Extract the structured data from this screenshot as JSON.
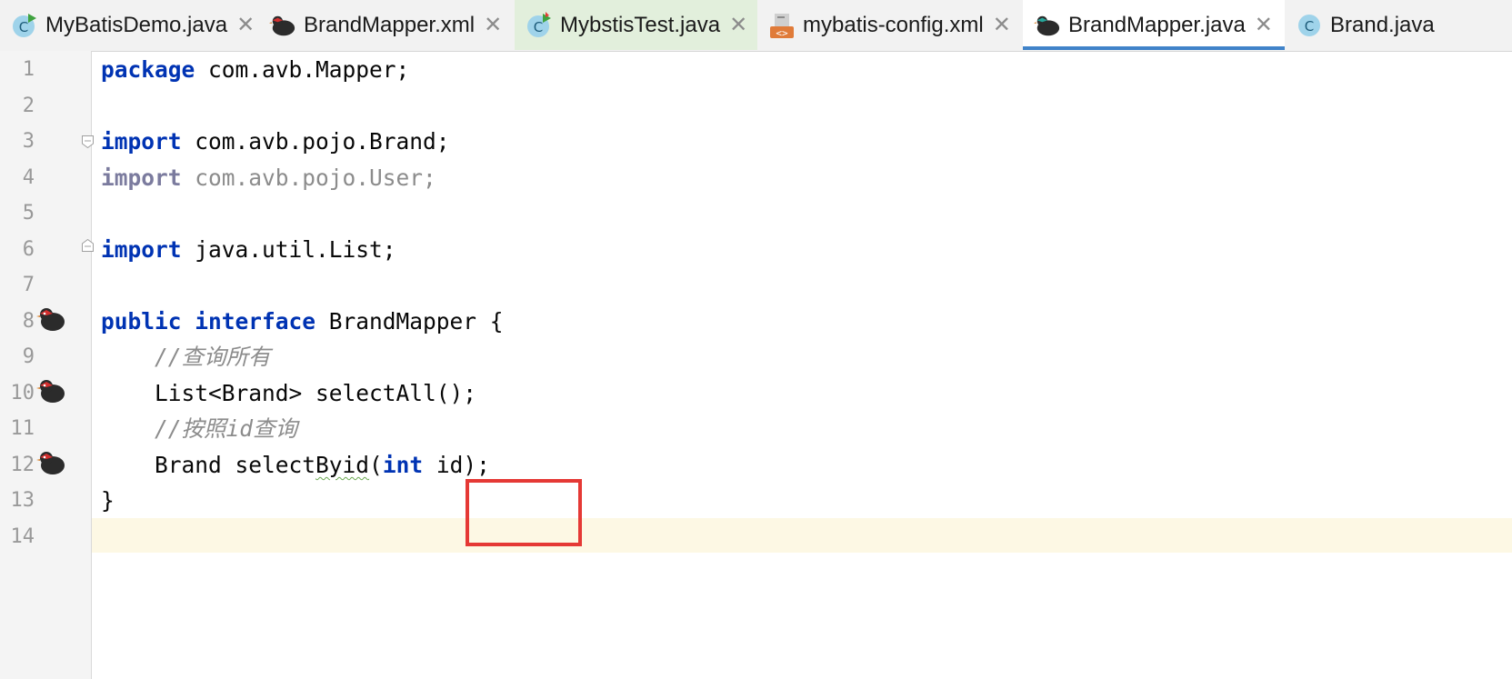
{
  "tabs": [
    {
      "label": "MyBatisDemo.java",
      "icon": "java-class-run-icon",
      "closable": true
    },
    {
      "label": "BrandMapper.xml",
      "icon": "mybatis-bird-icon",
      "closable": true
    },
    {
      "label": "MybstisTest.java",
      "icon": "java-class-run-icon",
      "closable": true
    },
    {
      "label": "mybatis-config.xml",
      "icon": "xml-file-icon",
      "closable": true
    },
    {
      "label": "BrandMapper.java",
      "icon": "mybatis-bird-icon",
      "closable": true,
      "active": true
    },
    {
      "label": "Brand.java",
      "icon": "java-class-icon",
      "closable": false
    }
  ],
  "line_numbers": [
    "1",
    "2",
    "3",
    "4",
    "5",
    "6",
    "7",
    "8",
    "9",
    "10",
    "11",
    "12",
    "13",
    "14"
  ],
  "code": {
    "l1": {
      "kw": "package",
      "rest": " com.avb.Mapper;"
    },
    "l3": {
      "kw": "import",
      "rest": " com.avb.pojo.Brand;"
    },
    "l4": {
      "kw": "import",
      "rest": " com.avb.pojo.User;"
    },
    "l6": {
      "kw": "import",
      "rest": " java.util.List;"
    },
    "l8": {
      "kw1": "public",
      "kw2": "interface",
      "rest": " BrandMapper {"
    },
    "l9": {
      "indent": "    ",
      "comment": "//查询所有"
    },
    "l10": {
      "indent": "    ",
      "text": "List<Brand> selectAll();"
    },
    "l11": {
      "indent": "    ",
      "comment": "//按照id查询"
    },
    "l12": {
      "indent": "    ",
      "pre": "Brand select",
      "squig": "Byid",
      "paren": "(",
      "kw": "int",
      "post": " id);"
    },
    "l13": {
      "text": "}"
    }
  },
  "colors": {
    "keyword": "#0033b3",
    "comment": "#8c8c8c",
    "unused_import": "#8c8c8c",
    "active_tab_underline": "#4083c9",
    "caret_line": "#fdf8e4",
    "highlight_box": "#e53935"
  }
}
